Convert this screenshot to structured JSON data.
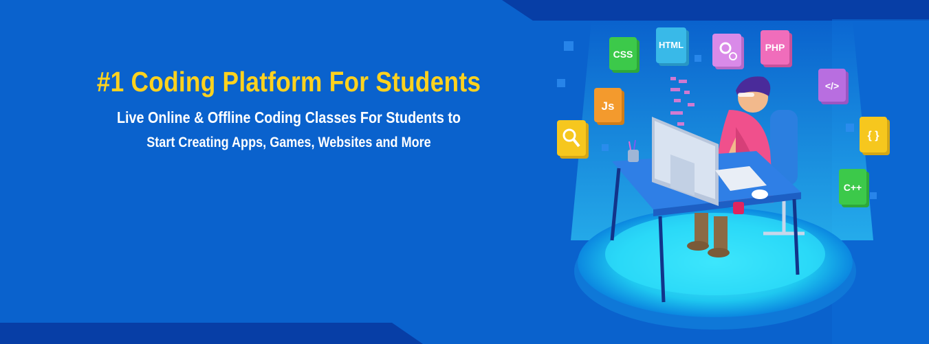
{
  "banner": {
    "headline": "#1 Coding Platform For Students",
    "subline_1": "Live Online & Offline Coding Classes For Students to",
    "subline_2": "Start Creating Apps, Games, Websites and More"
  },
  "colors": {
    "background": "#0a62cd",
    "dark_band": "#073ea6",
    "headline": "#ffd21e",
    "subtext": "#ffffff",
    "platform_glow": "#1fd8f5"
  },
  "tiles": [
    {
      "icon": "css-tile",
      "label": "CSS",
      "color": "#3cc94a"
    },
    {
      "icon": "html-tile",
      "label": "HTML",
      "color": "#39b9e8"
    },
    {
      "icon": "gears-tile",
      "label": "",
      "color": "#d98ae8"
    },
    {
      "icon": "php-tile",
      "label": "PHP",
      "color": "#f06dbb"
    },
    {
      "icon": "js-tile",
      "label": "Js",
      "color": "#f39a2d"
    },
    {
      "icon": "code-tile",
      "label": "</>",
      "color": "#b86ee0"
    },
    {
      "icon": "braces-tile",
      "label": "{ }",
      "color": "#f6c71e"
    },
    {
      "icon": "search-tile",
      "label": "",
      "color": "#f6c71e"
    },
    {
      "icon": "cpp-tile",
      "label": "C++",
      "color": "#3cc94a"
    }
  ]
}
